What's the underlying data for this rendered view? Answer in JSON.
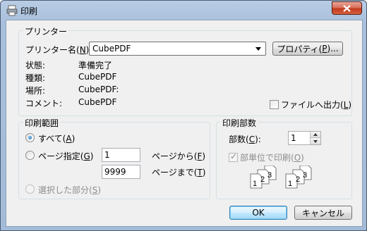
{
  "window": {
    "title": "印刷"
  },
  "printer": {
    "group_label": "プリンター",
    "name_label_prefix": "プリンター名(",
    "name_label_key": "N",
    "name_label_suffix": "):",
    "selected": "CubePDF",
    "properties_prefix": "プロパティ(",
    "properties_key": "P",
    "properties_suffix": ")...",
    "status_label": "状態:",
    "status_value": "準備完了",
    "type_label": "種類:",
    "type_value": "CubePDF",
    "where_label": "場所:",
    "where_value": "CubePDF:",
    "comment_label": "コメント:",
    "comment_value": "CubePDF",
    "print_to_file_prefix": "ファイルへ出力(",
    "print_to_file_key": "L",
    "print_to_file_suffix": ")"
  },
  "range": {
    "group_label": "印刷範囲",
    "all_prefix": "すべて(",
    "all_key": "A",
    "all_suffix": ")",
    "pages_prefix": "ページ指定(",
    "pages_key": "G",
    "pages_suffix": ")",
    "from_value": "1",
    "from_label_prefix": "ページから(",
    "from_label_key": "F",
    "from_label_suffix": ")",
    "to_value": "9999",
    "to_label_prefix": "ページまで(",
    "to_label_key": "T",
    "to_label_suffix": ")",
    "selection_prefix": "選択した部分(",
    "selection_key": "S",
    "selection_suffix": ")"
  },
  "copies": {
    "group_label": "印刷部数",
    "count_label_prefix": "部数(",
    "count_label_key": "C",
    "count_label_suffix": "):",
    "count_value": "1",
    "collate_prefix": "部単位で印刷(",
    "collate_key": "O",
    "collate_suffix": ")",
    "page_numbers": [
      "1",
      "2",
      "3"
    ]
  },
  "buttons": {
    "ok": "OK",
    "cancel": "キャンセル"
  },
  "colors": {
    "titlebar": "#a9c0dc",
    "close": "#c23a1f",
    "dialog_bg": "#f0f0f0",
    "default_btn": "#3c7fb1"
  }
}
